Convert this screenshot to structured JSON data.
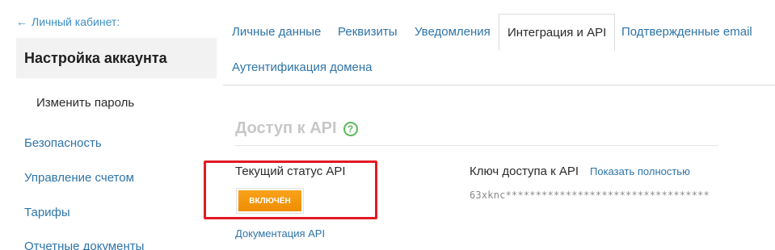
{
  "sidebar": {
    "back_label": "Личный кабинет:",
    "account_title": "Настройка аккаунта",
    "sub_item": "Изменить пароль",
    "items": [
      {
        "label": "Безопасность"
      },
      {
        "label": "Управление счетом"
      },
      {
        "label": "Тарифы"
      },
      {
        "label": "Отчетные документы"
      }
    ]
  },
  "tabs": [
    {
      "label": "Личные данные"
    },
    {
      "label": "Реквизиты"
    },
    {
      "label": "Уведомления"
    },
    {
      "label": "Интеграция и API",
      "active": true
    },
    {
      "label": "Подтвержденные email"
    },
    {
      "label": "Аутентификация домена"
    }
  ],
  "section": {
    "title": "Доступ к API",
    "help_glyph": "?"
  },
  "api_status": {
    "label": "Текущий статус API",
    "button": "ВКЛЮЧЁН",
    "doc_link": "Документация API"
  },
  "api_key": {
    "label": "Ключ доступа к API",
    "show_link": "Показать полностью",
    "value": "63xknc**********************************"
  },
  "colors": {
    "accent_link": "#2e74a8",
    "status_on": "#f39a12",
    "highlight_frame": "#e21a23",
    "help_icon": "#5cb85c"
  }
}
